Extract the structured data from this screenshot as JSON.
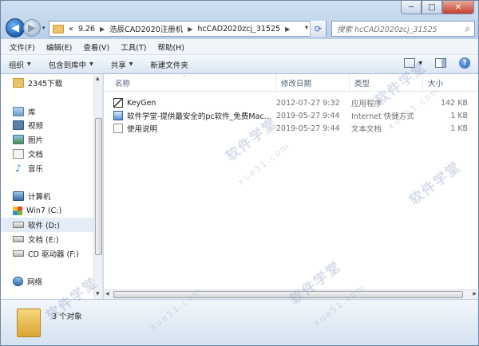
{
  "window": {
    "caption_buttons": {
      "minimize": "─",
      "maximize": "□",
      "close": "✕"
    }
  },
  "nav": {
    "back": "◀",
    "forward": "▶",
    "dropdown": "▾"
  },
  "address": {
    "prefix": "«",
    "crumbs": [
      "9.26",
      "浩辰CAD2020注册机",
      "hcCAD2020zcj_31525"
    ],
    "separator": "▶",
    "dropdown": "▾",
    "refresh": "⟳"
  },
  "search": {
    "placeholder": "搜索 hcCAD2020zcj_31525",
    "icon": "⌕"
  },
  "menu": [
    "文件(F)",
    "编辑(E)",
    "查看(V)",
    "工具(T)",
    "帮助(H)"
  ],
  "commands": {
    "organize": "组织",
    "include_library": "包含到库中",
    "share": "共享",
    "new_folder": "新建文件夹",
    "caret": "▼",
    "help": "?"
  },
  "sidebar": {
    "items": [
      {
        "label": "2345下载",
        "icon": "folder"
      },
      {
        "label": "库",
        "icon": "library"
      },
      {
        "label": "视频",
        "icon": "video"
      },
      {
        "label": "图片",
        "icon": "pictures"
      },
      {
        "label": "文档",
        "icon": "documents"
      },
      {
        "label": "音乐",
        "icon": "music"
      },
      {
        "label": "计算机",
        "icon": "computer"
      },
      {
        "label": "Win7 (C:)",
        "icon": "windows-drive"
      },
      {
        "label": "软件 (D:)",
        "icon": "drive",
        "selected": true
      },
      {
        "label": "文档 (E:)",
        "icon": "drive"
      },
      {
        "label": "CD 驱动器 (F:)",
        "icon": "cd-drive"
      },
      {
        "label": "网络",
        "icon": "network"
      }
    ],
    "music_glyph": "♪",
    "expand": "▸"
  },
  "columns": {
    "name": "名称",
    "date": "修改日期",
    "type": "类型",
    "size": "大小",
    "sort_indicator": "⌃"
  },
  "files": [
    {
      "name": "KeyGen",
      "date": "2012-07-27 9:32",
      "type": "应用程序",
      "size": "142 KB",
      "icon": "application"
    },
    {
      "name": "软件学堂-提供最安全的pc软件_免费Mac...",
      "date": "2019-05-27 9:44",
      "type": "Internet 快捷方式",
      "size": "1 KB",
      "icon": "internet-shortcut"
    },
    {
      "name": "使用说明",
      "date": "2019-05-27 9:44",
      "type": "文本文档",
      "size": "1 KB",
      "icon": "text-document"
    }
  ],
  "scroll": {
    "up": "▲",
    "down": "▼",
    "left": "◀",
    "right": "▶"
  },
  "status": {
    "count": "3 个对象"
  },
  "watermark": {
    "cn": "软件学堂",
    "en": "xue51.com"
  },
  "colors": {
    "accent": "#1b5fb0",
    "pane": "#c9d9ec",
    "selected": "#e3ecf7"
  }
}
